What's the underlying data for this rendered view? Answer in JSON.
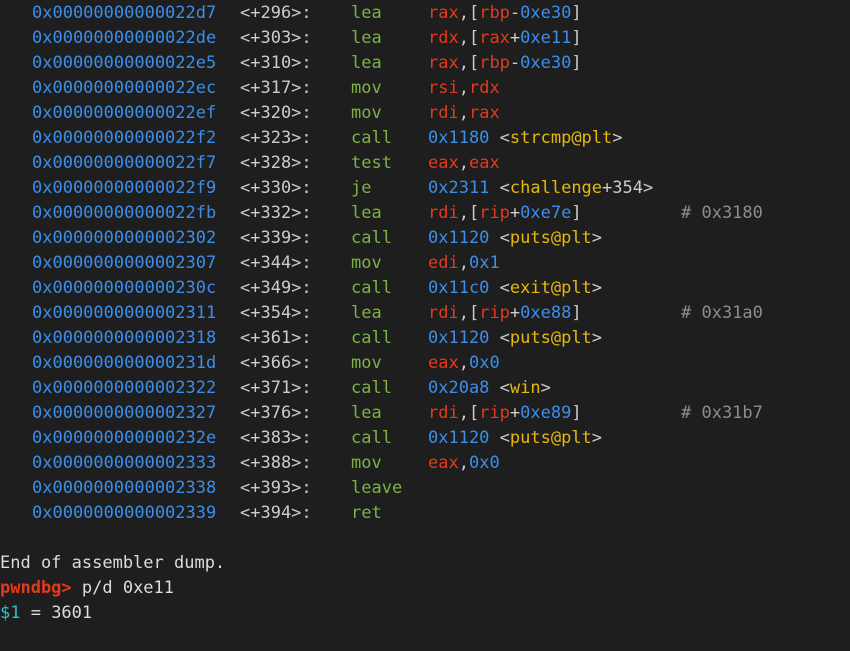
{
  "colors": {
    "background": "#1e1e1e",
    "address": "#3b8eea",
    "offset": "#cccccc",
    "mnemonic": "#7cb342",
    "register": "#e5391b",
    "immediate": "#3b8eea",
    "symbol": "#e5b80b",
    "comment": "#8c8c8c",
    "prompt": "#e5391b",
    "history_var": "#2ec4c4"
  },
  "disassembly": [
    {
      "addr": "0x00000000000022d7",
      "offset": "<+296>:",
      "mnemonic": "lea",
      "operands": [
        {
          "t": "reg",
          "v": "rax"
        },
        {
          "t": "pl",
          "v": ",["
        },
        {
          "t": "reg",
          "v": "rbp"
        },
        {
          "t": "pl",
          "v": "-"
        },
        {
          "t": "num",
          "v": "0xe30"
        },
        {
          "t": "pl",
          "v": "]"
        }
      ],
      "comment": ""
    },
    {
      "addr": "0x00000000000022de",
      "offset": "<+303>:",
      "mnemonic": "lea",
      "operands": [
        {
          "t": "reg",
          "v": "rdx"
        },
        {
          "t": "pl",
          "v": ",["
        },
        {
          "t": "reg",
          "v": "rax"
        },
        {
          "t": "pl",
          "v": "+"
        },
        {
          "t": "num",
          "v": "0xe11"
        },
        {
          "t": "pl",
          "v": "]"
        }
      ],
      "comment": ""
    },
    {
      "addr": "0x00000000000022e5",
      "offset": "<+310>:",
      "mnemonic": "lea",
      "operands": [
        {
          "t": "reg",
          "v": "rax"
        },
        {
          "t": "pl",
          "v": ",["
        },
        {
          "t": "reg",
          "v": "rbp"
        },
        {
          "t": "pl",
          "v": "-"
        },
        {
          "t": "num",
          "v": "0xe30"
        },
        {
          "t": "pl",
          "v": "]"
        }
      ],
      "comment": ""
    },
    {
      "addr": "0x00000000000022ec",
      "offset": "<+317>:",
      "mnemonic": "mov",
      "operands": [
        {
          "t": "reg",
          "v": "rsi"
        },
        {
          "t": "pl",
          "v": ","
        },
        {
          "t": "reg",
          "v": "rdx"
        }
      ],
      "comment": ""
    },
    {
      "addr": "0x00000000000022ef",
      "offset": "<+320>:",
      "mnemonic": "mov",
      "operands": [
        {
          "t": "reg",
          "v": "rdi"
        },
        {
          "t": "pl",
          "v": ","
        },
        {
          "t": "reg",
          "v": "rax"
        }
      ],
      "comment": ""
    },
    {
      "addr": "0x00000000000022f2",
      "offset": "<+323>:",
      "mnemonic": "call",
      "operands": [
        {
          "t": "num",
          "v": "0x1180"
        },
        {
          "t": "pl",
          "v": " <"
        },
        {
          "t": "sym",
          "v": "strcmp@plt"
        },
        {
          "t": "pl",
          "v": ">"
        }
      ],
      "comment": ""
    },
    {
      "addr": "0x00000000000022f7",
      "offset": "<+328>:",
      "mnemonic": "test",
      "operands": [
        {
          "t": "reg",
          "v": "eax"
        },
        {
          "t": "pl",
          "v": ","
        },
        {
          "t": "reg",
          "v": "eax"
        }
      ],
      "comment": ""
    },
    {
      "addr": "0x00000000000022f9",
      "offset": "<+330>:",
      "mnemonic": "je",
      "operands": [
        {
          "t": "num",
          "v": "0x2311"
        },
        {
          "t": "pl",
          "v": " <"
        },
        {
          "t": "sym",
          "v": "challenge"
        },
        {
          "t": "pl",
          "v": "+354>"
        }
      ],
      "comment": ""
    },
    {
      "addr": "0x00000000000022fb",
      "offset": "<+332>:",
      "mnemonic": "lea",
      "operands": [
        {
          "t": "reg",
          "v": "rdi"
        },
        {
          "t": "pl",
          "v": ",["
        },
        {
          "t": "reg",
          "v": "rip"
        },
        {
          "t": "pl",
          "v": "+"
        },
        {
          "t": "num",
          "v": "0xe7e"
        },
        {
          "t": "pl",
          "v": "]"
        }
      ],
      "comment": "# 0x3180"
    },
    {
      "addr": "0x0000000000002302",
      "offset": "<+339>:",
      "mnemonic": "call",
      "operands": [
        {
          "t": "num",
          "v": "0x1120"
        },
        {
          "t": "pl",
          "v": " <"
        },
        {
          "t": "sym",
          "v": "puts@plt"
        },
        {
          "t": "pl",
          "v": ">"
        }
      ],
      "comment": ""
    },
    {
      "addr": "0x0000000000002307",
      "offset": "<+344>:",
      "mnemonic": "mov",
      "operands": [
        {
          "t": "reg",
          "v": "edi"
        },
        {
          "t": "pl",
          "v": ","
        },
        {
          "t": "num",
          "v": "0x1"
        }
      ],
      "comment": ""
    },
    {
      "addr": "0x000000000000230c",
      "offset": "<+349>:",
      "mnemonic": "call",
      "operands": [
        {
          "t": "num",
          "v": "0x11c0"
        },
        {
          "t": "pl",
          "v": " <"
        },
        {
          "t": "sym",
          "v": "exit@plt"
        },
        {
          "t": "pl",
          "v": ">"
        }
      ],
      "comment": ""
    },
    {
      "addr": "0x0000000000002311",
      "offset": "<+354>:",
      "mnemonic": "lea",
      "operands": [
        {
          "t": "reg",
          "v": "rdi"
        },
        {
          "t": "pl",
          "v": ",["
        },
        {
          "t": "reg",
          "v": "rip"
        },
        {
          "t": "pl",
          "v": "+"
        },
        {
          "t": "num",
          "v": "0xe88"
        },
        {
          "t": "pl",
          "v": "]"
        }
      ],
      "comment": "# 0x31a0"
    },
    {
      "addr": "0x0000000000002318",
      "offset": "<+361>:",
      "mnemonic": "call",
      "operands": [
        {
          "t": "num",
          "v": "0x1120"
        },
        {
          "t": "pl",
          "v": " <"
        },
        {
          "t": "sym",
          "v": "puts@plt"
        },
        {
          "t": "pl",
          "v": ">"
        }
      ],
      "comment": ""
    },
    {
      "addr": "0x000000000000231d",
      "offset": "<+366>:",
      "mnemonic": "mov",
      "operands": [
        {
          "t": "reg",
          "v": "eax"
        },
        {
          "t": "pl",
          "v": ","
        },
        {
          "t": "num",
          "v": "0x0"
        }
      ],
      "comment": ""
    },
    {
      "addr": "0x0000000000002322",
      "offset": "<+371>:",
      "mnemonic": "call",
      "operands": [
        {
          "t": "num",
          "v": "0x20a8"
        },
        {
          "t": "pl",
          "v": " <"
        },
        {
          "t": "sym",
          "v": "win"
        },
        {
          "t": "pl",
          "v": ">"
        }
      ],
      "comment": ""
    },
    {
      "addr": "0x0000000000002327",
      "offset": "<+376>:",
      "mnemonic": "lea",
      "operands": [
        {
          "t": "reg",
          "v": "rdi"
        },
        {
          "t": "pl",
          "v": ",["
        },
        {
          "t": "reg",
          "v": "rip"
        },
        {
          "t": "pl",
          "v": "+"
        },
        {
          "t": "num",
          "v": "0xe89"
        },
        {
          "t": "pl",
          "v": "]"
        }
      ],
      "comment": "# 0x31b7"
    },
    {
      "addr": "0x000000000000232e",
      "offset": "<+383>:",
      "mnemonic": "call",
      "operands": [
        {
          "t": "num",
          "v": "0x1120"
        },
        {
          "t": "pl",
          "v": " <"
        },
        {
          "t": "sym",
          "v": "puts@plt"
        },
        {
          "t": "pl",
          "v": ">"
        }
      ],
      "comment": ""
    },
    {
      "addr": "0x0000000000002333",
      "offset": "<+388>:",
      "mnemonic": "mov",
      "operands": [
        {
          "t": "reg",
          "v": "eax"
        },
        {
          "t": "pl",
          "v": ","
        },
        {
          "t": "num",
          "v": "0x0"
        }
      ],
      "comment": ""
    },
    {
      "addr": "0x0000000000002338",
      "offset": "<+393>:",
      "mnemonic": "leave",
      "operands": [],
      "comment": ""
    },
    {
      "addr": "0x0000000000002339",
      "offset": "<+394>:",
      "mnemonic": "ret",
      "operands": [],
      "comment": ""
    }
  ],
  "footer": {
    "end_message": "End of assembler dump.",
    "prompt": "pwndbg>",
    "command": " p/d 0xe11",
    "result_var": "$1",
    "result_text": " = 3601"
  }
}
